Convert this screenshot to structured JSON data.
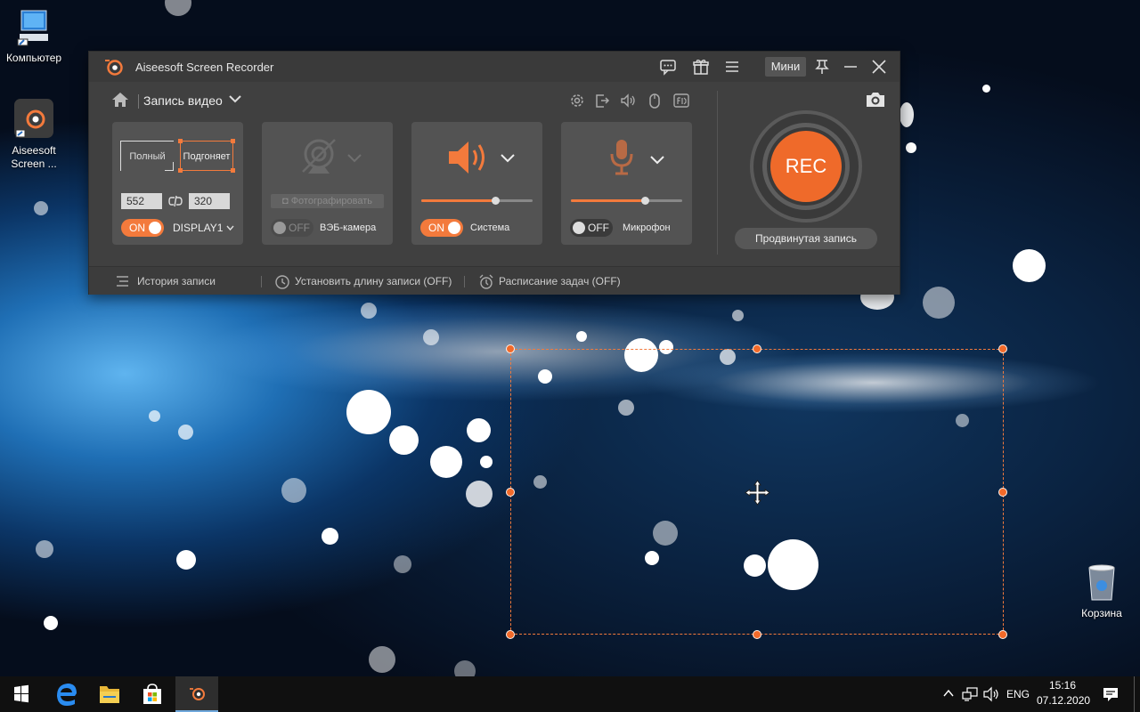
{
  "desktop": {
    "icons": [
      {
        "label": "Компьютер"
      },
      {
        "label": "Aiseesoft Screen ..."
      },
      {
        "label": "Корзина"
      }
    ]
  },
  "app": {
    "title": "Aiseesoft Screen Recorder",
    "mini_label": "Мини",
    "mode_label": "Запись видео",
    "region": {
      "full_label": "Полный",
      "fit_label": "Подгоняет",
      "width": "552",
      "height": "320",
      "toggle": "ON",
      "display": "DISPLAY1"
    },
    "webcam": {
      "photo_label": "Фотографировать",
      "toggle": "OFF",
      "label": "ВЭБ-камера"
    },
    "system": {
      "toggle": "ON",
      "label": "Система",
      "volume": 0.66
    },
    "mic": {
      "toggle": "OFF",
      "label": "Микрофон",
      "volume": 0.66
    },
    "rec_label": "REC",
    "advanced_label": "Продвинутая запись",
    "bottom": {
      "history": "История записи",
      "length": "Установить длину записи (OFF)",
      "schedule": "Расписание задач (OFF)"
    },
    "accent_color": "#f37a3c"
  },
  "taskbar": {
    "language": "ENG",
    "time": "15:16",
    "date": "07.12.2020"
  }
}
